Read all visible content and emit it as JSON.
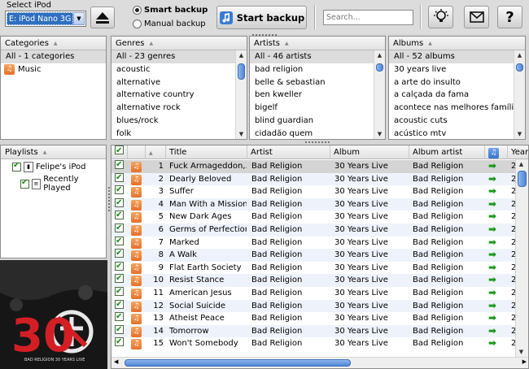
{
  "toolbar": {
    "select_label": "Select iPod",
    "ipod_value": "E: iPod Nano 3G",
    "smart_backup": "Smart backup",
    "manual_backup": "Manual backup",
    "start_backup": "Start backup",
    "search_placeholder": "Search..."
  },
  "categories": {
    "header": "Categories",
    "items": [
      "All - 1 categories",
      "Music"
    ]
  },
  "genres": {
    "header": "Genres",
    "items": [
      "All - 23 genres",
      "acoustic",
      "alternative",
      "alternative country",
      "alternative rock",
      "blues/rock",
      "folk"
    ]
  },
  "artists": {
    "header": "Artists",
    "items": [
      "All - 46 artists",
      "bad religion",
      "belle & sebastian",
      "ben kweller",
      "bigelf",
      "blind guardian",
      "cidadão quem"
    ]
  },
  "albums": {
    "header": "Albums",
    "items": [
      "All - 52 albums",
      "30 years live",
      "a arte do insulto",
      "a calçada da fama",
      "acontece nas melhores famílias",
      "acoustic cuts",
      "acústico mtv"
    ]
  },
  "playlists": {
    "header": "Playlists",
    "device": "Felipe's iPod",
    "items": [
      "Recently Played"
    ]
  },
  "tracks": {
    "columns": [
      "Title",
      "Artist",
      "Album",
      "Album artist",
      "Year"
    ],
    "rows": [
      {
        "n": "1",
        "title": "Fuck Armageddon,...",
        "artist": "Bad Religion",
        "album": "30 Years Live",
        "album_artist": "Bad Religion",
        "year": "2"
      },
      {
        "n": "2",
        "title": "Dearly Beloved",
        "artist": "Bad Religion",
        "album": "30 Years Live",
        "album_artist": "Bad Religion",
        "year": "2"
      },
      {
        "n": "3",
        "title": "Suffer",
        "artist": "Bad Religion",
        "album": "30 Years Live",
        "album_artist": "Bad Religion",
        "year": "2"
      },
      {
        "n": "4",
        "title": "Man With a Mission",
        "artist": "Bad Religion",
        "album": "30 Years Live",
        "album_artist": "Bad Religion",
        "year": "2"
      },
      {
        "n": "5",
        "title": "New Dark Ages",
        "artist": "Bad Religion",
        "album": "30 Years Live",
        "album_artist": "Bad Religion",
        "year": "2"
      },
      {
        "n": "6",
        "title": "Germs of Perfection",
        "artist": "Bad Religion",
        "album": "30 Years Live",
        "album_artist": "Bad Religion",
        "year": "2"
      },
      {
        "n": "7",
        "title": "Marked",
        "artist": "Bad Religion",
        "album": "30 Years Live",
        "album_artist": "Bad Religion",
        "year": "2"
      },
      {
        "n": "8",
        "title": "A Walk",
        "artist": "Bad Religion",
        "album": "30 Years Live",
        "album_artist": "Bad Religion",
        "year": "2"
      },
      {
        "n": "9",
        "title": "Flat Earth Society",
        "artist": "Bad Religion",
        "album": "30 Years Live",
        "album_artist": "Bad Religion",
        "year": "2"
      },
      {
        "n": "10",
        "title": "Resist Stance",
        "artist": "Bad Religion",
        "album": "30 Years Live",
        "album_artist": "Bad Religion",
        "year": "2"
      },
      {
        "n": "11",
        "title": "American Jesus",
        "artist": "Bad Religion",
        "album": "30 Years Live",
        "album_artist": "Bad Religion",
        "year": "2"
      },
      {
        "n": "12",
        "title": "Social Suicide",
        "artist": "Bad Religion",
        "album": "30 Years Live",
        "album_artist": "Bad Religion",
        "year": "2"
      },
      {
        "n": "13",
        "title": "Atheist Peace",
        "artist": "Bad Religion",
        "album": "30 Years Live",
        "album_artist": "Bad Religion",
        "year": "2"
      },
      {
        "n": "14",
        "title": "Tomorrow",
        "artist": "Bad Religion",
        "album": "30 Years Live",
        "album_artist": "Bad Religion",
        "year": "2"
      },
      {
        "n": "15",
        "title": "Won't Somebody",
        "artist": "Bad Religion",
        "album": "30 Years Live",
        "album_artist": "Bad Religion",
        "year": "2"
      }
    ]
  },
  "album_art": {
    "big_text": "30",
    "caption": "BAD RELIGION 30 YEARS LIVE"
  },
  "colors": {
    "selection": "#2f6fbf",
    "row_alt": "#eef3fb",
    "send_arrow": "#1e9a1e",
    "art_red": "#d31f24"
  }
}
